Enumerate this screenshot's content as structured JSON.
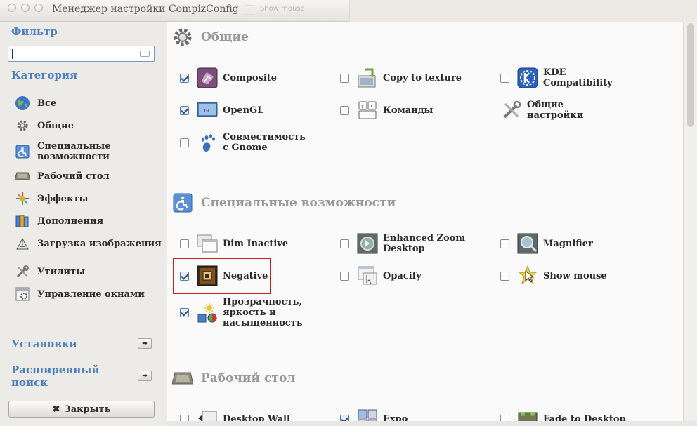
{
  "window": {
    "title": "Менеджер настройки CompizConfig",
    "ghost_title": "Show mouse"
  },
  "sidebar": {
    "filter_heading": "Фильтр",
    "search_value": "",
    "category_heading": "Категория",
    "categories": [
      {
        "label": "Все",
        "icon": "globe-icon"
      },
      {
        "label": "Общие",
        "icon": "gear-icon"
      },
      {
        "label": "Специальные возможности",
        "icon": "accessibility-icon"
      },
      {
        "label": "Рабочий стол",
        "icon": "desktop-icon"
      },
      {
        "label": "Эффекты",
        "icon": "effects-icon"
      },
      {
        "label": "Дополнения",
        "icon": "extras-icon"
      },
      {
        "label": "Загрузка изображения",
        "icon": "image-loading-icon"
      },
      {
        "label": "Утилиты",
        "icon": "utilities-icon"
      },
      {
        "label": "Управление окнами",
        "icon": "window-management-icon"
      }
    ],
    "settings_label": "Установки",
    "advanced_search_label": "Расширенный поиск",
    "close_label": "Закрыть"
  },
  "sections": [
    {
      "title": "Общие",
      "icon": "gear-icon",
      "items": [
        {
          "label": "Composite",
          "checked": true,
          "icon": "composite-icon"
        },
        {
          "label": "Copy to texture",
          "checked": false,
          "icon": "copy-to-texture-icon"
        },
        {
          "label": "KDE Compatibility",
          "checked": false,
          "icon": "kde-icon"
        },
        {
          "label": "OpenGL",
          "checked": true,
          "icon": "opengl-icon"
        },
        {
          "label": "Команды",
          "checked": false,
          "icon": "commands-icon"
        },
        {
          "label": "Общие настройки",
          "checked": null,
          "icon": "tools-icon"
        },
        {
          "label": "Совместимость с Gnome",
          "checked": false,
          "icon": "gnome-icon"
        }
      ]
    },
    {
      "title": "Специальные возможности",
      "icon": "accessibility-icon",
      "items": [
        {
          "label": "Dim Inactive",
          "checked": false,
          "icon": "dim-inactive-icon"
        },
        {
          "label": "Enhanced Zoom Desktop",
          "checked": false,
          "icon": "enhanced-zoom-icon"
        },
        {
          "label": "Magnifier",
          "checked": false,
          "icon": "magnifier-icon"
        },
        {
          "label": "Negative",
          "checked": true,
          "icon": "negative-icon"
        },
        {
          "label": "Opacify",
          "checked": false,
          "icon": "opacify-icon"
        },
        {
          "label": "Show mouse",
          "checked": false,
          "icon": "show-mouse-icon"
        },
        {
          "label": "Прозрачность, яркость и насыщенность",
          "checked": true,
          "icon": "opacity-brightness-icon"
        }
      ]
    },
    {
      "title": "Рабочий стол",
      "icon": "desktop-icon",
      "items": [
        {
          "label": "Desktop Wall",
          "checked": false,
          "icon": "desktop-wall-icon"
        },
        {
          "label": "Expo",
          "checked": true,
          "icon": "expo-icon"
        },
        {
          "label": "Fade to Desktop",
          "checked": false,
          "icon": "fade-to-desktop-icon"
        }
      ]
    }
  ],
  "colors": {
    "accent": "#4d7fc4",
    "highlight_box": "#d01f1f"
  }
}
